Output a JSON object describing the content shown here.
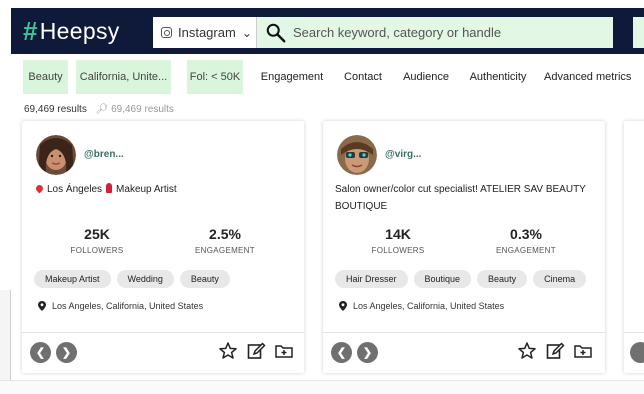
{
  "header": {
    "logo_text": "Heepsy",
    "logo_mark": "#",
    "platform_label": "Instagram",
    "search_placeholder": "Search keyword, category or handle"
  },
  "filters": [
    {
      "label": "Beauty",
      "active": true
    },
    {
      "label": "California, Unite...",
      "active": true
    },
    {
      "label": "Fol: < 50K",
      "active": true
    },
    {
      "label": "Engagement",
      "active": false
    },
    {
      "label": "Contact",
      "active": false
    },
    {
      "label": "Audience",
      "active": false
    },
    {
      "label": "Authenticity",
      "active": false
    },
    {
      "label": "Advanced metrics",
      "active": false
    }
  ],
  "results": {
    "count_text": "69,469 results",
    "muted_text": "69,469 results"
  },
  "cards": [
    {
      "handle": "@bren...",
      "bio": "Los Ángeles",
      "bio_extra": "Makeup Artist",
      "followers": "25K",
      "followers_label": "FOLLOWERS",
      "engagement": "2.5%",
      "engagement_label": "ENGAGEMENT",
      "tags": [
        "Makeup Artist",
        "Wedding",
        "Beauty"
      ],
      "location": "Los Angeles, California, United States"
    },
    {
      "handle": "@virg...",
      "bio": "Salon owner/color cut specialist! ATELIER SAV BEAUTY BOUTIQUE",
      "followers": "14K",
      "followers_label": "FOLLOWERS",
      "engagement": "0.3%",
      "engagement_label": "ENGAGEMENT",
      "tags": [
        "Hair Dresser",
        "Boutique",
        "Beauty",
        "Cinema"
      ],
      "location": "Los Angeles, California, United States"
    }
  ],
  "icons": {
    "prev": "chevron-left-icon",
    "next": "chevron-right-icon",
    "favorite": "star-icon",
    "note": "edit-icon",
    "add_to_list": "folder-plus-icon"
  },
  "colors": {
    "header_bg": "#0f1a3a",
    "accent_green": "#3cc49a",
    "filter_active_bg": "#d9f5dc",
    "search_bg": "#e2f7e4",
    "handle_color": "#3a6f64"
  }
}
